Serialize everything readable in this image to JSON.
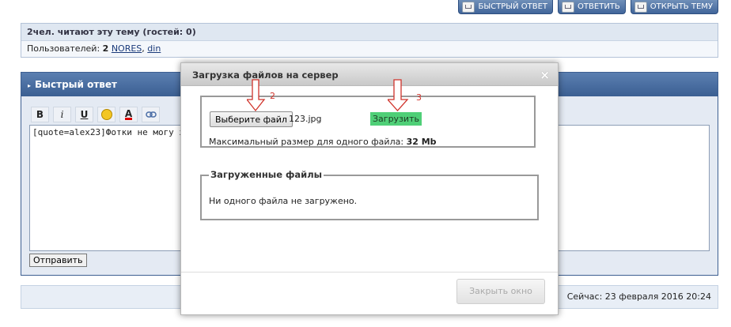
{
  "top_buttons": [
    {
      "label": "БЫСТРЫЙ ОТВЕТ",
      "icon": "reply-icon"
    },
    {
      "label": "ОТВЕТИТЬ",
      "icon": "reply-icon"
    },
    {
      "label": "ОТКРЫТЬ ТЕМУ",
      "icon": "new-topic-icon"
    }
  ],
  "readers": {
    "header": "2чел. читают эту тему (гостей: 0)",
    "users_prefix": "Пользователей:",
    "users_count": "2",
    "user1": "NORES",
    "separator": ",",
    "user2": "din"
  },
  "quick_reply": {
    "title": "Быстрый ответ",
    "toolbar": {
      "bold": "B",
      "italic": "i",
      "underline": "U",
      "color": "A"
    },
    "editor_text": "[quote=alex23]Фотки не могу за",
    "send_label": "Отправить"
  },
  "footer": {
    "now_text": "Сейчас: 23 февраля 2016 20:24"
  },
  "modal": {
    "title": "Загрузка файлов на сервер",
    "close_x": "×",
    "choose_file_label": "Выберите файл",
    "file_name": "123.jpg",
    "upload_label": "Загрузить",
    "max_size_label": "Максимальный размер для одного файла:",
    "max_size_value": "32 Mb",
    "uploaded_legend": "Загруженные файлы",
    "no_files_text": "Ни одного файла не загружено.",
    "close_window_label": "Закрыть окно"
  },
  "annotations": {
    "arrow1_number": "2",
    "arrow2_number": "3",
    "color": "#d0332b"
  },
  "colors": {
    "accent": "#3b5f92",
    "upload_button": "#4fcf77"
  }
}
